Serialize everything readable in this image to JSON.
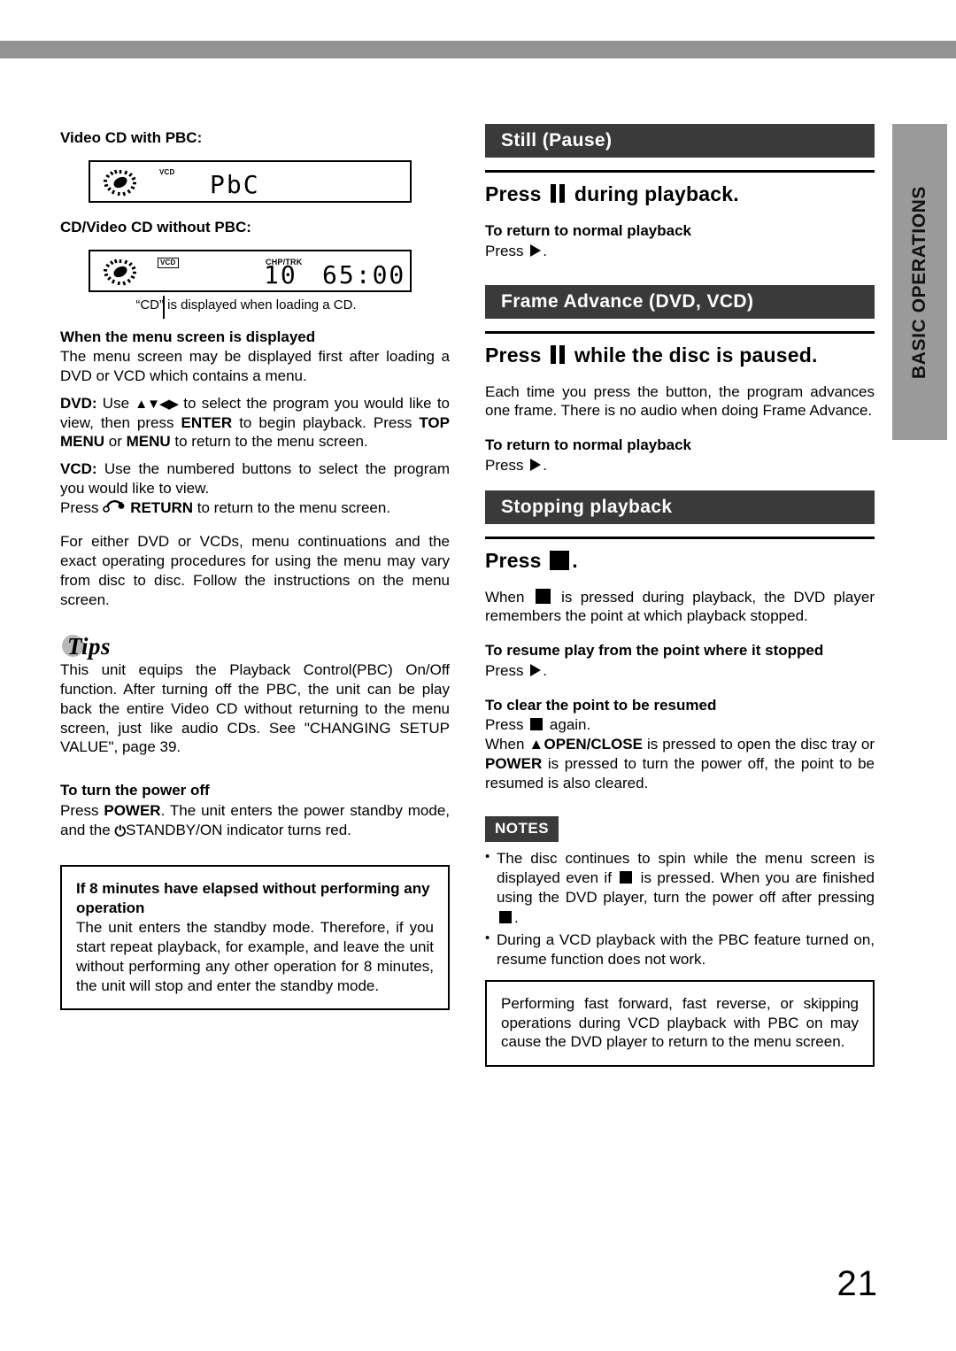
{
  "page": {
    "number": "21",
    "side_tab_label": "BASIC OPERATIONS"
  },
  "left_column": {
    "display_pbc": {
      "heading": "Video CD with PBC:",
      "spin_icon": "spinning-disc-icon",
      "disc_tag": "VCD",
      "segment_text": "PbC"
    },
    "display_nopbc": {
      "heading": "CD/Video CD without PBC:",
      "spin_icon": "spinning-disc-icon",
      "disc_tag": "VCD",
      "field_label": "CHP/TRK",
      "chapter_value": "10",
      "time_value": "65:00",
      "caption": "“CD” is displayed when loading a CD."
    },
    "menu_section": {
      "heading": "When the menu screen is displayed",
      "intro": "The menu screen may be displayed first after loading a DVD or VCD which contains a menu.",
      "dvd_label": "DVD:",
      "dvd_text_1": " Use ",
      "dvd_arrows": "▲▼◀▶",
      "dvd_text_2": " to select the program you would like to view, then press ",
      "dvd_enter": "ENTER",
      "dvd_text_3": " to begin playback.  Press ",
      "dvd_topmenu": "TOP MENU",
      "dvd_text_4": " or ",
      "dvd_menu": "MENU",
      "dvd_text_5": " to return to the menu screen.",
      "vcd_label": "VCD:",
      "vcd_text_1": " Use the numbered buttons to select the program you would like to view.",
      "vcd_press": "Press ",
      "vcd_return": "RETURN",
      "vcd_text_2": " to return to the menu screen.",
      "closing": "For either DVD or VCDs, menu continuations and the exact operating procedures for using the menu may vary from disc to disc.  Follow the instructions on the menu screen."
    },
    "tips": {
      "title": "Tips",
      "body": "This unit equips the Playback Control(PBC) On/Off function. After turning off the PBC, the unit can be play back the entire Video CD without returning to the menu screen, just like audio CDs. See \"CHANGING SETUP VALUE\", page 39."
    },
    "power_off": {
      "heading": "To turn the power off",
      "text_1": "Press ",
      "power_label": "POWER",
      "text_2": ". The unit enters the power standby mode, and the ",
      "standby_symbol": "⏻",
      "standby_label": "STANDBY/ON",
      "text_3": " indicator turns red."
    },
    "eight_minutes_box": {
      "heading": "If 8 minutes have elapsed without performing any operation",
      "body": "The unit enters the standby mode. Therefore, if you start repeat playback, for example, and leave the unit without performing any other operation for 8 minutes, the unit will stop and enter the standby mode."
    }
  },
  "right_column": {
    "still_pause": {
      "header": "Still (Pause)",
      "lead_pre": "Press ",
      "lead_glyph": "pause-icon",
      "lead_post": " during playback.",
      "sub_heading": "To return to normal playback",
      "sub_press": "Press ",
      "sub_glyph": "play-icon",
      "sub_post": "."
    },
    "frame_advance": {
      "header": "Frame Advance (DVD, VCD)",
      "lead_pre": "Press ",
      "lead_glyph": "pause-icon",
      "lead_post": " while the disc is paused.",
      "body": "Each time you press the button, the program advances one frame.  There is no audio when doing Frame Advance.",
      "sub_heading": "To return to normal playback",
      "sub_press": "Press ",
      "sub_glyph": "play-icon",
      "sub_post": "."
    },
    "stopping_playback": {
      "header": "Stopping playback",
      "lead_pre": "Press ",
      "lead_glyph": "stop-icon",
      "lead_post": ".",
      "body_pre": "When ",
      "body_glyph": "stop-icon",
      "body_post": " is pressed during playback, the DVD player remembers the point at which playback stopped.",
      "resume_heading": "To resume play from the point where it stopped",
      "resume_press": "Press ",
      "resume_glyph": "play-icon",
      "resume_post": ".",
      "clear_heading": "To clear the point to be resumed",
      "clear_press": "Press ",
      "clear_glyph": "stop-icon",
      "clear_post": " again.",
      "clear_line2_pre": "When ",
      "clear_eject": "▲OPEN/CLOSE",
      "clear_line2_mid": " is pressed to open the disc tray or ",
      "clear_power": "POWER",
      "clear_line2_post": "  is pressed to turn the power off, the point to be resumed is also cleared."
    },
    "notes": {
      "tag": "NOTES",
      "item1_pre": "The disc continues to spin while the menu screen is displayed even if ",
      "item1_glyph": "stop-icon",
      "item1_mid": " is  pressed.  When you are finished using the DVD player, turn the power off after pressing ",
      "item1_glyph2": "stop-icon",
      "item1_post": ".",
      "item2": "During a VCD playback with the PBC feature turned on, resume function does not work."
    },
    "boxed_note": {
      "body": "Performing fast forward, fast reverse, or skipping operations during VCD playback with PBC on may cause the DVD player to return to the menu screen."
    }
  },
  "colors": {
    "header_bar": "#3a3a3a",
    "side_tab": "#9a9a9a",
    "top_rule": "#939393",
    "tips_dot": "#b8b8b8"
  }
}
